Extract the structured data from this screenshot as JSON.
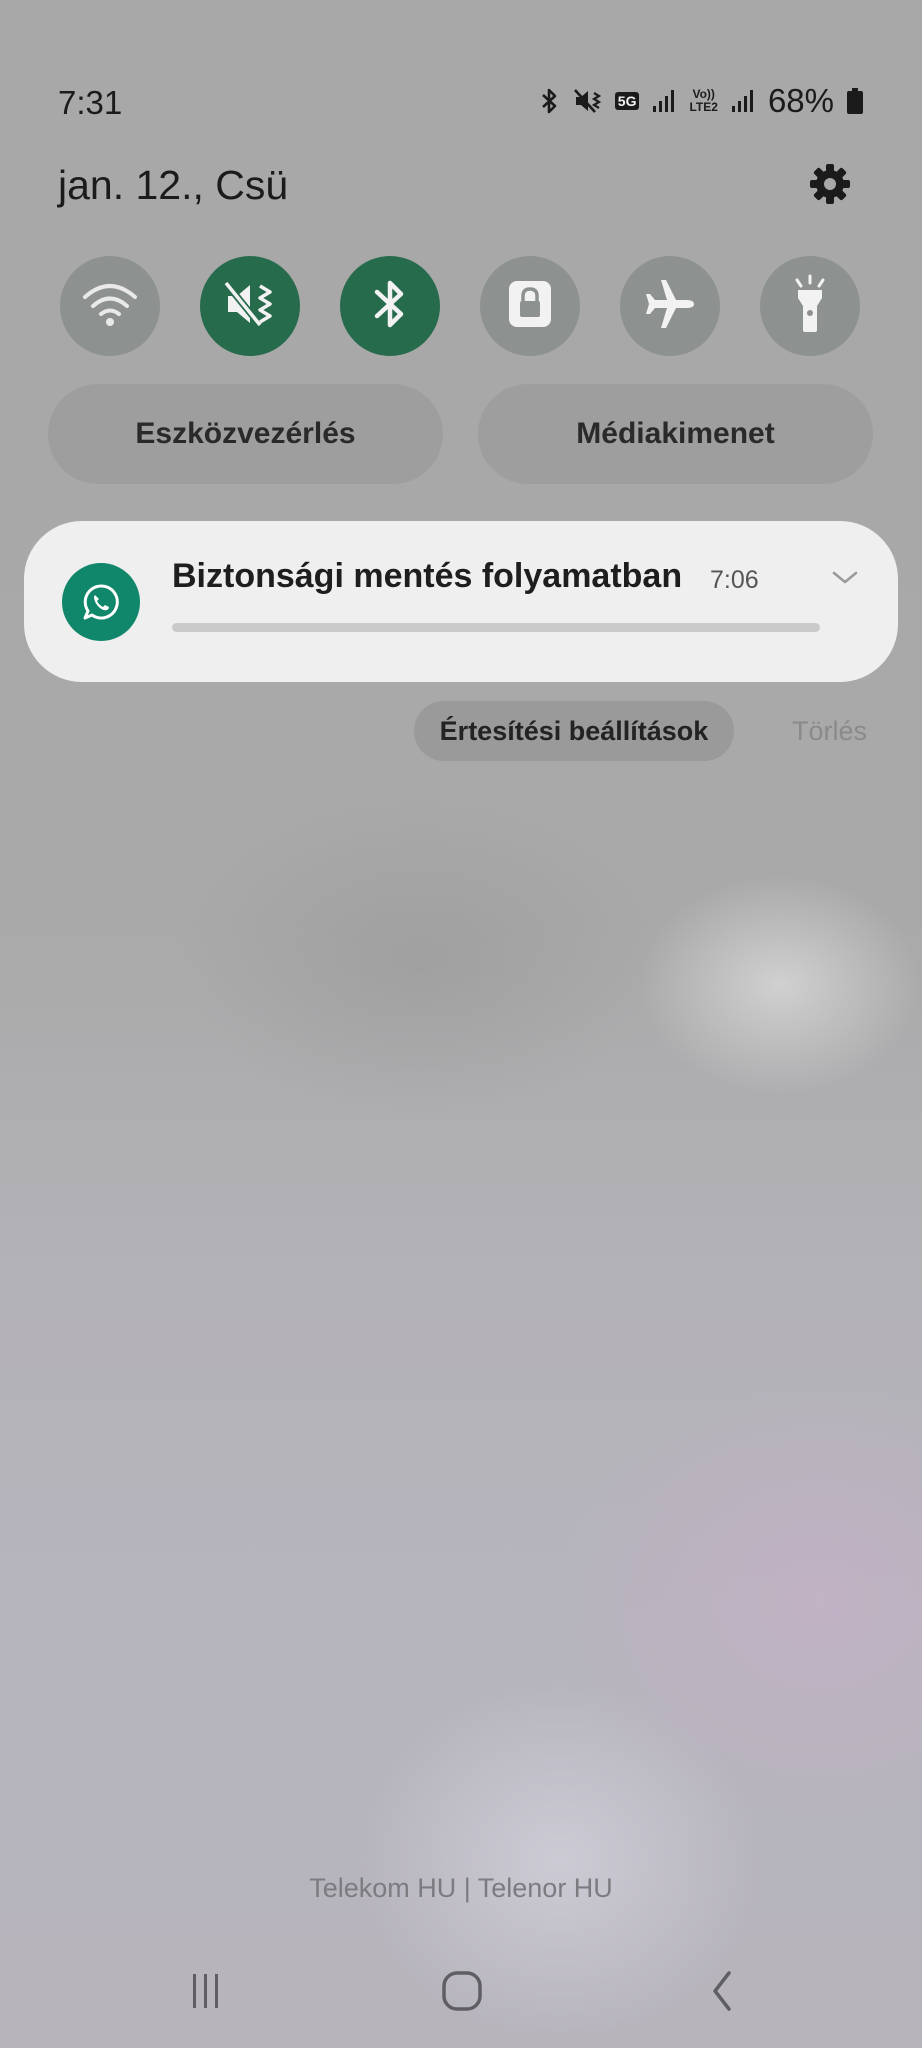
{
  "status_bar": {
    "time": "7:31",
    "network_badge": "5G",
    "volte_top": "Vo))",
    "volte_bottom": "LTE2",
    "battery_percent": "68%",
    "icons": [
      "bluetooth-icon",
      "mute-vibrate-icon",
      "5g-icon",
      "signal-icon",
      "volte-icon",
      "signal-icon",
      "battery-icon"
    ]
  },
  "header": {
    "date": "jan. 12., Csü",
    "settings_icon": "gear-icon"
  },
  "quick_toggles": [
    {
      "name": "wifi",
      "icon": "wifi-icon",
      "active": false
    },
    {
      "name": "sound",
      "icon": "mute-vibrate-icon",
      "active": true
    },
    {
      "name": "bluetooth",
      "icon": "bluetooth-icon",
      "active": true
    },
    {
      "name": "rotation-lock",
      "icon": "lock-icon",
      "active": false
    },
    {
      "name": "airplane-mode",
      "icon": "airplane-icon",
      "active": false
    },
    {
      "name": "flashlight",
      "icon": "flashlight-icon",
      "active": false
    }
  ],
  "pills": {
    "device_control": "Eszközvezérlés",
    "media_output": "Médiakimenet"
  },
  "notification": {
    "app_icon": "whatsapp-icon",
    "title": "Biztonsági mentés folyamatban",
    "time": "7:06",
    "expand_icon": "chevron-down-icon",
    "progress": 0
  },
  "notification_actions": {
    "settings": "Értesítési beállítások",
    "clear": "Törlés"
  },
  "carrier_text": "Telekom HU | Telenor HU",
  "nav_bar": {
    "recents_icon": "recents-icon",
    "home_icon": "home-icon",
    "back_icon": "back-icon"
  },
  "colors": {
    "toggle_active": "#276b4d",
    "toggle_inactive": "#8d918f",
    "whatsapp_green": "#10866a"
  }
}
